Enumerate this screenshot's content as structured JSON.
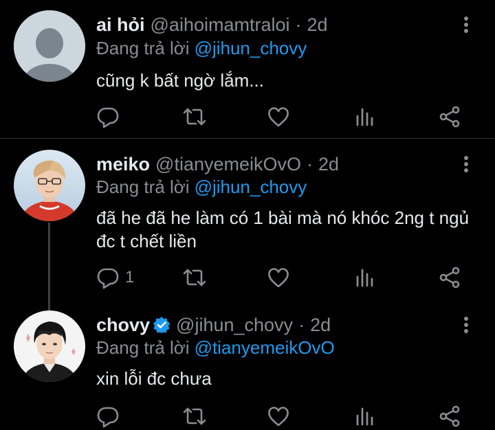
{
  "tweets": [
    {
      "display_name": "ai hỏi",
      "handle": "@aihoimamtraloi",
      "separator": "·",
      "time": "2d",
      "reply_prefix": "Đang trả lời",
      "reply_to": "@jihun_chovy",
      "text": "cũng k bất ngờ lắm...",
      "avatar": "default-avatar",
      "verified": false,
      "reply_count": ""
    },
    {
      "display_name": "meiko",
      "handle": "@tianyemeikOvO",
      "separator": "·",
      "time": "2d",
      "reply_prefix": "Đang trả lời",
      "reply_to": "@jihun_chovy",
      "text": "đã he đã he làm có 1 bài mà nó khóc 2ng t ngủ đc t chết liền",
      "avatar": "photo-avatar-meiko",
      "verified": false,
      "reply_count": "1"
    },
    {
      "display_name": "chovy",
      "handle": "@jihun_chovy",
      "separator": "·",
      "time": "2d",
      "reply_prefix": "Đang trả lời",
      "reply_to": "@tianyemeikOvO",
      "text": "xin lỗi đc chưa",
      "avatar": "photo-avatar-chovy",
      "verified": true,
      "reply_count": ""
    }
  ],
  "icons": {
    "reply": "reply-icon",
    "retweet": "retweet-icon",
    "like": "like-icon",
    "views": "analytics-icon",
    "share": "share-icon",
    "more": "more-options-icon",
    "verified": "verified-badge-icon"
  },
  "colors": {
    "background": "#000000",
    "text": "#e7e9ea",
    "muted": "#8a8d91",
    "link": "#1d9bf0",
    "verified": "#1d9bf0",
    "divider": "#2f3336"
  }
}
